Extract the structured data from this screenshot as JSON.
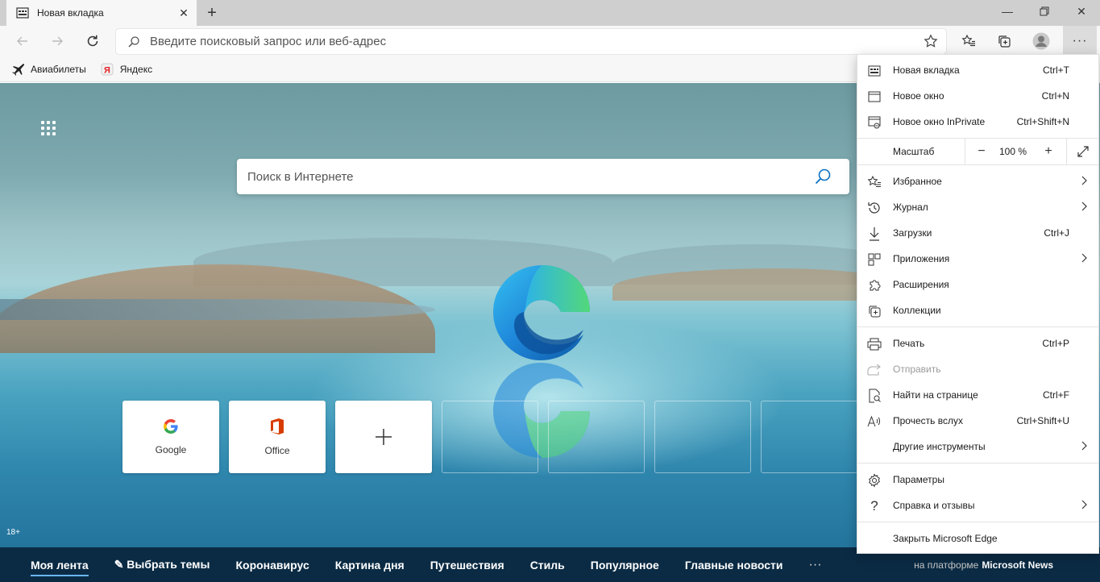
{
  "tab": {
    "title": "Новая вкладка"
  },
  "address": {
    "placeholder": "Введите поисковый запрос или веб-адрес"
  },
  "favorites": [
    {
      "label": "Авиабилеты",
      "icon": "plane-icon"
    },
    {
      "label": "Яндекс",
      "icon": "yandex-icon"
    }
  ],
  "page": {
    "search_placeholder": "Поиск в Интернете",
    "tiles": [
      {
        "label": "Google",
        "icon": "google-icon"
      },
      {
        "label": "Office",
        "icon": "office-icon"
      },
      {
        "label": "",
        "icon": "plus-icon"
      }
    ],
    "age_badge": "18+"
  },
  "news": {
    "items": [
      "Моя лента",
      "✎ Выбрать темы",
      "Коронавирус",
      "Картина дня",
      "Путешествия",
      "Стиль",
      "Популярное",
      "Главные новости"
    ],
    "more": "···",
    "powered_prefix": "на платформе",
    "powered_brand": "Microsoft News"
  },
  "menu": {
    "new_tab": {
      "label": "Новая вкладка",
      "shortcut": "Ctrl+T"
    },
    "new_window": {
      "label": "Новое окно",
      "shortcut": "Ctrl+N"
    },
    "inprivate": {
      "label": "Новое окно InPrivate",
      "shortcut": "Ctrl+Shift+N"
    },
    "zoom": {
      "label": "Масштаб",
      "value": "100 %",
      "minus": "−",
      "plus": "+"
    },
    "favorites": {
      "label": "Избранное"
    },
    "history": {
      "label": "Журнал"
    },
    "downloads": {
      "label": "Загрузки",
      "shortcut": "Ctrl+J"
    },
    "apps": {
      "label": "Приложения"
    },
    "extensions": {
      "label": "Расширения"
    },
    "collections": {
      "label": "Коллекции"
    },
    "print": {
      "label": "Печать",
      "shortcut": "Ctrl+P"
    },
    "share": {
      "label": "Отправить"
    },
    "find": {
      "label": "Найти на странице",
      "shortcut": "Ctrl+F"
    },
    "read_aloud": {
      "label": "Прочесть вслух",
      "shortcut": "Ctrl+Shift+U"
    },
    "more_tools": {
      "label": "Другие инструменты"
    },
    "settings": {
      "label": "Параметры"
    },
    "help": {
      "label": "Справка и отзывы"
    },
    "close": {
      "label": "Закрыть Microsoft Edge"
    }
  },
  "colors": {
    "accent": "#0078d4",
    "news_bar": "#0b2b44"
  }
}
